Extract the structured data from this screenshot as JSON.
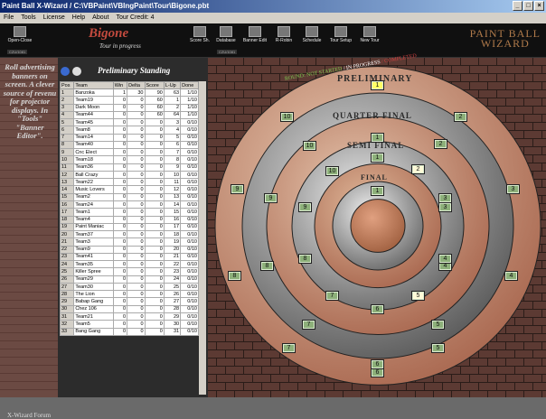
{
  "window": {
    "title": "Paint Ball X-Wizard / C:\\VBPaint\\VBIngPaint\\Tour\\Bigone.pbt"
  },
  "menu": [
    "File",
    "Tools",
    "License",
    "Help",
    "About",
    "Tour Credit: 4"
  ],
  "toolbar": {
    "open_close": "Open-Close",
    "score_sh": "Score Sh.",
    "database": "Database",
    "banner_edit": "Banner Edit",
    "r_robin": "R-Robin",
    "schedule": "Schedule",
    "tour_setup": "Tour Setup",
    "new_tour": "New Tour",
    "cz_left": "CZU/1081",
    "cz_right": "CZU/1081"
  },
  "app": {
    "title": "Bigone",
    "subtitle": "Tour in progress",
    "logo_line1": "PAINT BALL",
    "logo_line2": "WIZARD"
  },
  "ad": {
    "text": "Roll advertising banners on screen. A clever source of revenu for projector displays. In \"Tools\" \"Banner Editor\".",
    "footer": "X-Wizard Forum"
  },
  "standings": {
    "title": "Preliminary Standing",
    "columns": [
      "Pos",
      "Team",
      "Win",
      "Delta",
      "Score",
      "L-Up",
      "Done"
    ],
    "rows": [
      [
        "1",
        "Banzoka",
        "1",
        "30",
        "90",
        "63",
        "1/10"
      ],
      [
        "2",
        "Team19",
        "0",
        "0",
        "60",
        "1",
        "1/10"
      ],
      [
        "3",
        "Dark Moon",
        "0",
        "0",
        "60",
        "2",
        "1/10"
      ],
      [
        "4",
        "Team44",
        "0",
        "0",
        "60",
        "64",
        "1/10"
      ],
      [
        "5",
        "Team45",
        "0",
        "0",
        "0",
        "3",
        "0/10"
      ],
      [
        "6",
        "Team8",
        "0",
        "0",
        "0",
        "4",
        "0/10"
      ],
      [
        "7",
        "Team14",
        "0",
        "0",
        "0",
        "5",
        "0/10"
      ],
      [
        "8",
        "Team40",
        "0",
        "0",
        "0",
        "6",
        "0/10"
      ],
      [
        "9",
        "Cnc Elect",
        "0",
        "0",
        "0",
        "7",
        "0/10"
      ],
      [
        "10",
        "Team18",
        "0",
        "0",
        "0",
        "8",
        "0/10"
      ],
      [
        "11",
        "Team36",
        "0",
        "0",
        "0",
        "9",
        "0/10"
      ],
      [
        "12",
        "Ball Crazy",
        "0",
        "0",
        "0",
        "10",
        "0/10"
      ],
      [
        "13",
        "Team22",
        "0",
        "0",
        "0",
        "11",
        "0/10"
      ],
      [
        "14",
        "Music Lovers",
        "0",
        "0",
        "0",
        "12",
        "0/10"
      ],
      [
        "15",
        "Team2",
        "0",
        "0",
        "0",
        "13",
        "0/10"
      ],
      [
        "16",
        "Team24",
        "0",
        "0",
        "0",
        "14",
        "0/10"
      ],
      [
        "17",
        "Team1",
        "0",
        "0",
        "0",
        "15",
        "0/10"
      ],
      [
        "18",
        "Team4",
        "0",
        "0",
        "0",
        "16",
        "0/10"
      ],
      [
        "19",
        "Paint Maniac",
        "0",
        "0",
        "0",
        "17",
        "0/10"
      ],
      [
        "20",
        "Team37",
        "0",
        "0",
        "0",
        "18",
        "0/10"
      ],
      [
        "21",
        "Team3",
        "0",
        "0",
        "0",
        "19",
        "0/10"
      ],
      [
        "22",
        "Team9",
        "0",
        "0",
        "0",
        "20",
        "0/10"
      ],
      [
        "23",
        "Team41",
        "0",
        "0",
        "0",
        "21",
        "0/10"
      ],
      [
        "24",
        "Team35",
        "0",
        "0",
        "0",
        "22",
        "0/10"
      ],
      [
        "25",
        "Killer Spree",
        "0",
        "0",
        "0",
        "23",
        "0/10"
      ],
      [
        "26",
        "Team29",
        "0",
        "0",
        "0",
        "24",
        "0/10"
      ],
      [
        "27",
        "Team30",
        "0",
        "0",
        "0",
        "25",
        "0/10"
      ],
      [
        "28",
        "The Lion",
        "0",
        "0",
        "0",
        "26",
        "0/10"
      ],
      [
        "29",
        "Babap Gang",
        "0",
        "0",
        "0",
        "27",
        "0/10"
      ],
      [
        "30",
        "Chez 106",
        "0",
        "0",
        "0",
        "28",
        "0/10"
      ],
      [
        "31",
        "Team21",
        "0",
        "0",
        "0",
        "29",
        "0/10"
      ],
      [
        "32",
        "Team5",
        "0",
        "0",
        "0",
        "30",
        "0/10"
      ],
      [
        "33",
        "Bang Gang",
        "0",
        "0",
        "0",
        "31",
        "0/10"
      ]
    ]
  },
  "bracket": {
    "legend": {
      "not_started": "ROUND: NOT STARTED",
      "in_progress": "IN PROGRESS",
      "completed": "COMPLETED"
    },
    "rounds": {
      "preliminary": "PRELIMINARY",
      "quarter": "QUARTER FINAL",
      "semi": "SEMI FINAL",
      "final": "FINAL"
    },
    "boxes": [
      {
        "n": "1",
        "t": "hl"
      },
      {
        "n": "10",
        "t": "g"
      },
      {
        "n": "2",
        "t": "g"
      },
      {
        "n": "9",
        "t": "g"
      },
      {
        "n": "3",
        "t": "g"
      },
      {
        "n": "8",
        "t": "g"
      },
      {
        "n": "4",
        "t": "g"
      },
      {
        "n": "7",
        "t": "g"
      },
      {
        "n": "5",
        "t": "g"
      },
      {
        "n": "6",
        "t": "g"
      },
      {
        "n": "1",
        "t": "g"
      },
      {
        "n": "10",
        "t": "g"
      },
      {
        "n": "2",
        "t": "g"
      },
      {
        "n": "9",
        "t": "g"
      },
      {
        "n": "3",
        "t": "g"
      },
      {
        "n": "8",
        "t": "g"
      },
      {
        "n": "4",
        "t": "g"
      },
      {
        "n": "7",
        "t": "g"
      },
      {
        "n": "5",
        "t": "g"
      },
      {
        "n": "6",
        "t": "g"
      },
      {
        "n": "1",
        "t": "g"
      },
      {
        "n": "10",
        "t": "g"
      },
      {
        "n": "2",
        "t": "wt"
      },
      {
        "n": "9",
        "t": "g"
      },
      {
        "n": "3",
        "t": "g"
      },
      {
        "n": "8",
        "t": "g"
      },
      {
        "n": "4",
        "t": "g"
      },
      {
        "n": "7",
        "t": "g"
      },
      {
        "n": "5",
        "t": "wt"
      },
      {
        "n": "6",
        "t": "g"
      },
      {
        "n": "1",
        "t": "g"
      }
    ]
  },
  "colors": {
    "not_started": "#7ec850",
    "in_progress": "#ffffff",
    "completed": "#d04040",
    "copper": "#b8765a",
    "steel": "#b8b8b8"
  }
}
